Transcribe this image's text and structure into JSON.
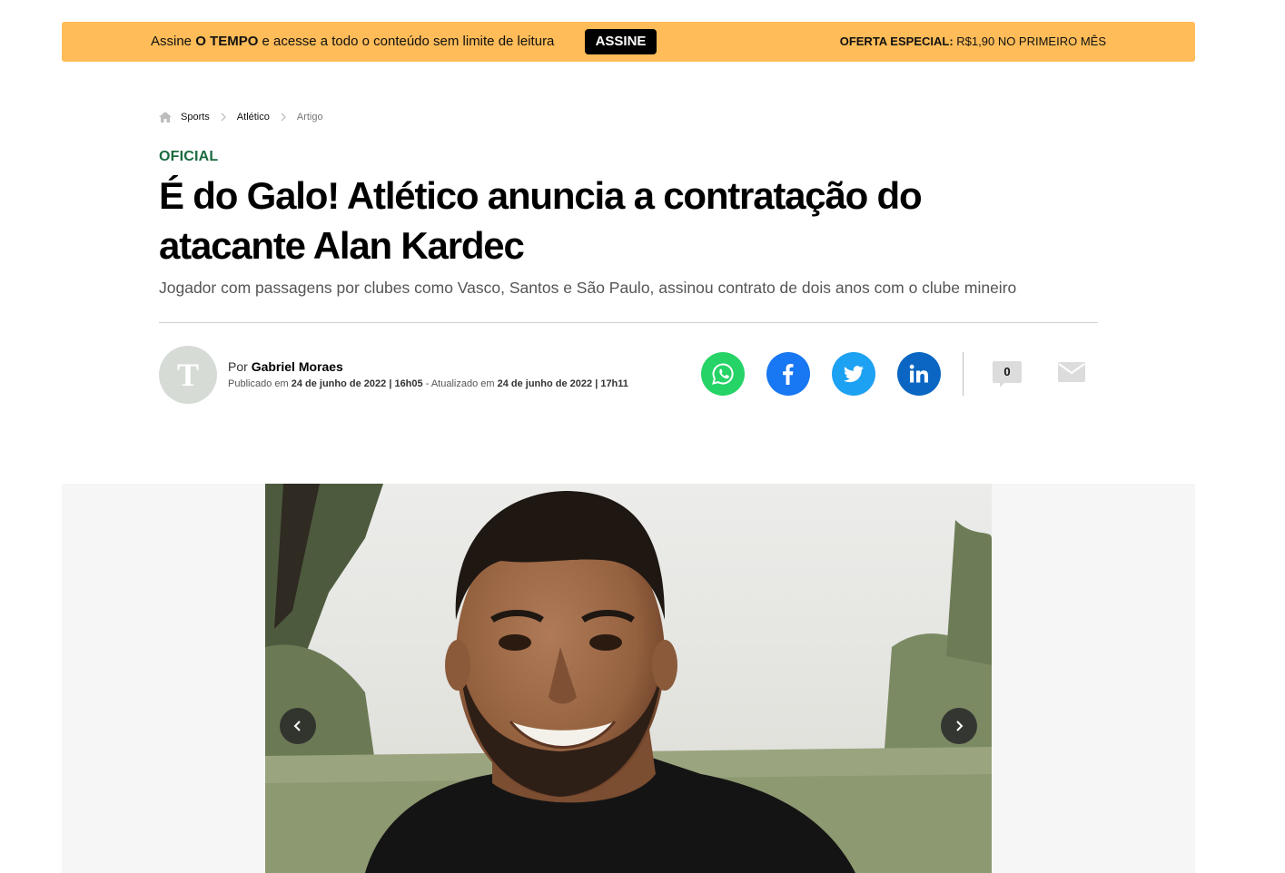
{
  "promo": {
    "lead": "Assine",
    "brand": "O TEMPO",
    "tail": "e acesse a todo o conteúdo sem limite de leitura",
    "button_label": "ASSINE",
    "offer_label": "OFERTA ESPECIAL:",
    "offer_value": "R$1,90 NO PRIMEIRO MÊS",
    "background_color": "#FFBC58"
  },
  "breadcrumb": {
    "home_icon": "home-icon",
    "items": [
      "Sports",
      "Atlético",
      "Artigo"
    ]
  },
  "article": {
    "kicker": "OFICIAL",
    "kicker_color": "#1a6b3f",
    "headline": "É do Galo! Atlético anuncia a contratação do atacante Alan Kardec",
    "subtitle": "Jogador com passagens por clubes como Vasco, Santos e São Paulo, assinou contrato de dois anos com o clube mineiro"
  },
  "author": {
    "avatar_letter": "T",
    "prefix": "Por",
    "name": "Gabriel Moraes",
    "published_prefix": "Publicado em",
    "published": "24 de junho de 2022 | 16h05",
    "updated_prefix": "- Atualizado em",
    "updated": "24 de junho de 2022 | 17h11"
  },
  "share": {
    "buttons": [
      {
        "icon": "whatsapp-icon",
        "color": "#25D366"
      },
      {
        "icon": "facebook-icon",
        "color": "#1877F2"
      },
      {
        "icon": "twitter-icon",
        "color": "#1DA1F2"
      },
      {
        "icon": "linkedin-icon",
        "color": "#0A66C2"
      }
    ],
    "comment_count": "0",
    "mail_icon": "mail-icon"
  },
  "gallery": {
    "prev_icon": "chevron-left-icon",
    "next_icon": "chevron-right-icon"
  }
}
